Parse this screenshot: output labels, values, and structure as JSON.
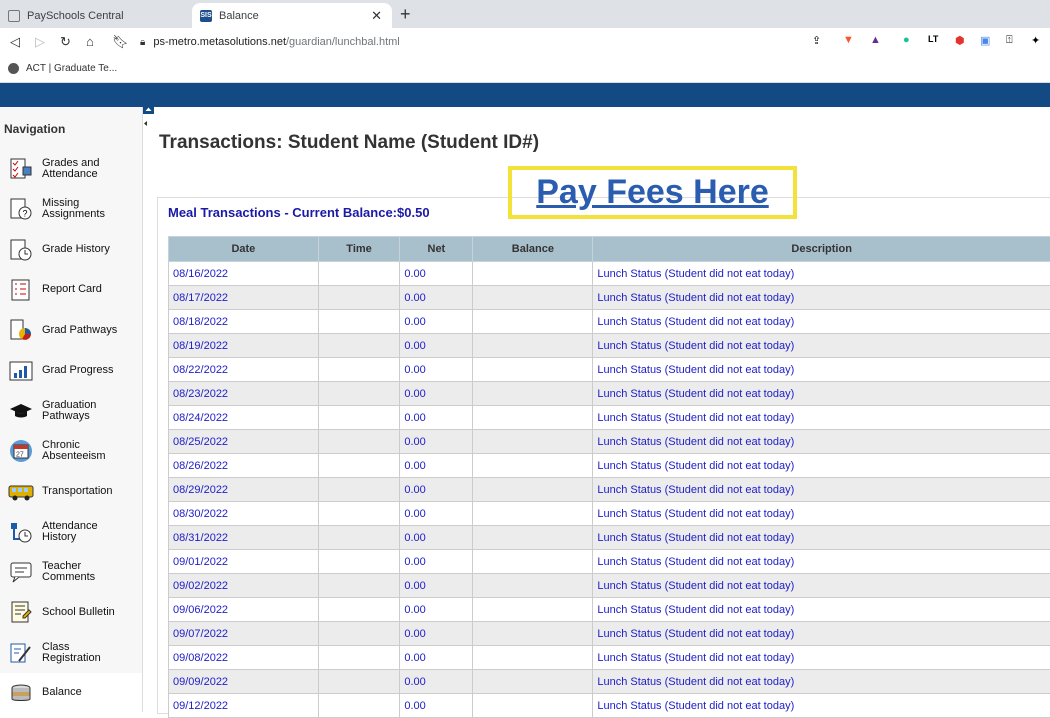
{
  "browser": {
    "tabs": [
      {
        "title": "PaySchools Central",
        "icon": "page-icon"
      },
      {
        "title": "Balance",
        "icon": "SIS",
        "active": true
      }
    ],
    "new_tab": "+",
    "url_host": "ps-metro.metasolutions.net",
    "url_path": "/guardian/lunchbal.html",
    "bookmark": "ACT | Graduate Te..."
  },
  "sidebar": {
    "title": "Navigation",
    "items": [
      {
        "label": "Grades and\nAttendance",
        "icon": "grades-icon"
      },
      {
        "label": "Missing\nAssignments",
        "icon": "missing-assignments-icon"
      },
      {
        "label": "Grade History",
        "icon": "grade-history-icon"
      },
      {
        "label": "Report Card",
        "icon": "report-card-icon"
      },
      {
        "label": "Grad Pathways",
        "icon": "grad-pathways-icon"
      },
      {
        "label": "Grad Progress",
        "icon": "grad-progress-icon"
      },
      {
        "label": "Graduation\nPathways",
        "icon": "graduation-cap-icon"
      },
      {
        "label": "Chronic\nAbsenteeism",
        "icon": "calendar-icon"
      },
      {
        "label": "Transportation",
        "icon": "bus-icon"
      },
      {
        "label": "Attendance\nHistory",
        "icon": "attendance-history-icon"
      },
      {
        "label": "Teacher\nComments",
        "icon": "comments-icon"
      },
      {
        "label": "School Bulletin",
        "icon": "bulletin-icon"
      },
      {
        "label": "Class\nRegistration",
        "icon": "registration-icon"
      },
      {
        "label": "Balance",
        "icon": "coins-icon"
      }
    ]
  },
  "main": {
    "title": "Transactions: Student Name (Student ID#)",
    "pay_fees": "Pay Fees Here",
    "panel_title": "Meal Transactions - Current Balance:$0.50",
    "columns": [
      "Date",
      "Time",
      "Net",
      "Balance",
      "Description"
    ],
    "rows": [
      [
        "08/16/2022",
        "",
        "0.00",
        "",
        "Lunch Status (Student did not eat today)"
      ],
      [
        "08/17/2022",
        "",
        "0.00",
        "",
        "Lunch Status (Student did not eat today)"
      ],
      [
        "08/18/2022",
        "",
        "0.00",
        "",
        "Lunch Status (Student did not eat today)"
      ],
      [
        "08/19/2022",
        "",
        "0.00",
        "",
        "Lunch Status (Student did not eat today)"
      ],
      [
        "08/22/2022",
        "",
        "0.00",
        "",
        "Lunch Status (Student did not eat today)"
      ],
      [
        "08/23/2022",
        "",
        "0.00",
        "",
        "Lunch Status (Student did not eat today)"
      ],
      [
        "08/24/2022",
        "",
        "0.00",
        "",
        "Lunch Status (Student did not eat today)"
      ],
      [
        "08/25/2022",
        "",
        "0.00",
        "",
        "Lunch Status (Student did not eat today)"
      ],
      [
        "08/26/2022",
        "",
        "0.00",
        "",
        "Lunch Status (Student did not eat today)"
      ],
      [
        "08/29/2022",
        "",
        "0.00",
        "",
        "Lunch Status (Student did not eat today)"
      ],
      [
        "08/30/2022",
        "",
        "0.00",
        "",
        "Lunch Status (Student did not eat today)"
      ],
      [
        "08/31/2022",
        "",
        "0.00",
        "",
        "Lunch Status (Student did not eat today)"
      ],
      [
        "09/01/2022",
        "",
        "0.00",
        "",
        "Lunch Status (Student did not eat today)"
      ],
      [
        "09/02/2022",
        "",
        "0.00",
        "",
        "Lunch Status (Student did not eat today)"
      ],
      [
        "09/06/2022",
        "",
        "0.00",
        "",
        "Lunch Status (Student did not eat today)"
      ],
      [
        "09/07/2022",
        "",
        "0.00",
        "",
        "Lunch Status (Student did not eat today)"
      ],
      [
        "09/08/2022",
        "",
        "0.00",
        "",
        "Lunch Status (Student did not eat today)"
      ],
      [
        "09/09/2022",
        "",
        "0.00",
        "",
        "Lunch Status (Student did not eat today)"
      ],
      [
        "09/12/2022",
        "",
        "0.00",
        "",
        "Lunch Status (Student did not eat today)"
      ]
    ]
  },
  "colors": {
    "header_bar": "#134a83",
    "table_header": "#a8bfcc",
    "link": "#2020c8",
    "pay_fees_border": "#f2e23a"
  }
}
